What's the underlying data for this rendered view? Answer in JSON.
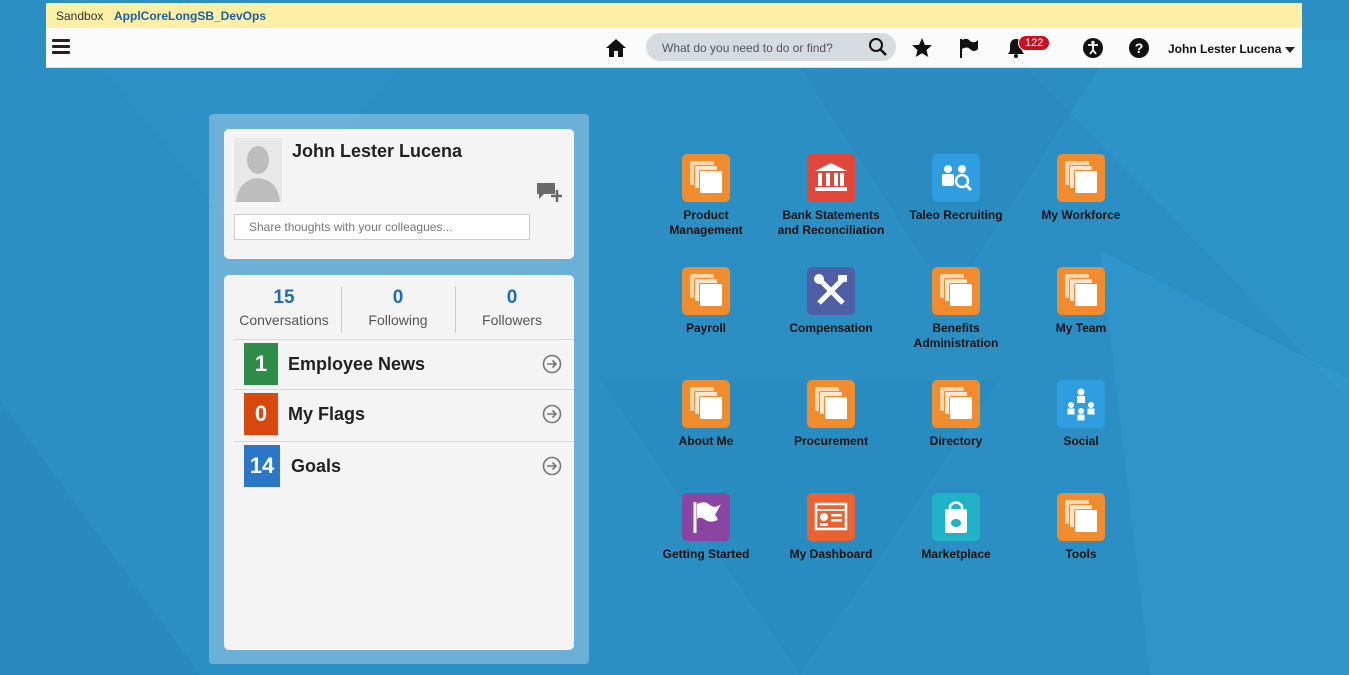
{
  "sandbox": {
    "label": "Sandbox",
    "name": "ApplCoreLongSB_DevOps"
  },
  "header": {
    "search_placeholder": "What do you need to do or find?",
    "notification_count": "122",
    "user_name": "John Lester Lucena"
  },
  "profile": {
    "name": "John Lester Lucena",
    "share_placeholder": "Share thoughts with your colleagues..."
  },
  "stats": [
    {
      "value": "15",
      "label": "Conversations"
    },
    {
      "value": "0",
      "label": "Following"
    },
    {
      "value": "0",
      "label": "Followers"
    }
  ],
  "rows": [
    {
      "count": "1",
      "label": "Employee News",
      "color": "#2e8b4a"
    },
    {
      "count": "0",
      "label": "My Flags",
      "color": "#d9480f"
    },
    {
      "count": "14",
      "label": "Goals",
      "color": "#2b77c7"
    }
  ],
  "apps": [
    {
      "line1": "Product",
      "line2": "Management",
      "icon": "stack-icon"
    },
    {
      "line1": "Bank Statements",
      "line2": "and Reconciliation",
      "icon": "bank-icon"
    },
    {
      "line1": "Taleo Recruiting",
      "line2": "",
      "icon": "recruiting-icon"
    },
    {
      "line1": "My Workforce",
      "line2": "",
      "icon": "stack-icon"
    },
    {
      "line1": "Payroll",
      "line2": "",
      "icon": "stack-icon"
    },
    {
      "line1": "Compensation",
      "line2": "",
      "icon": "tools-icon"
    },
    {
      "line1": "Benefits",
      "line2": "Administration",
      "icon": "stack-icon"
    },
    {
      "line1": "My Team",
      "line2": "",
      "icon": "stack-icon"
    },
    {
      "line1": "About Me",
      "line2": "",
      "icon": "stack-icon"
    },
    {
      "line1": "Procurement",
      "line2": "",
      "icon": "stack-icon"
    },
    {
      "line1": "Directory",
      "line2": "",
      "icon": "stack-icon"
    },
    {
      "line1": "Social",
      "line2": "",
      "icon": "social-icon"
    },
    {
      "line1": "Getting Started",
      "line2": "",
      "icon": "flag-icon"
    },
    {
      "line1": "My Dashboard",
      "line2": "",
      "icon": "dashboard-icon"
    },
    {
      "line1": "Marketplace",
      "line2": "",
      "icon": "marketplace-icon"
    },
    {
      "line1": "Tools",
      "line2": "",
      "icon": "stack-icon"
    }
  ]
}
